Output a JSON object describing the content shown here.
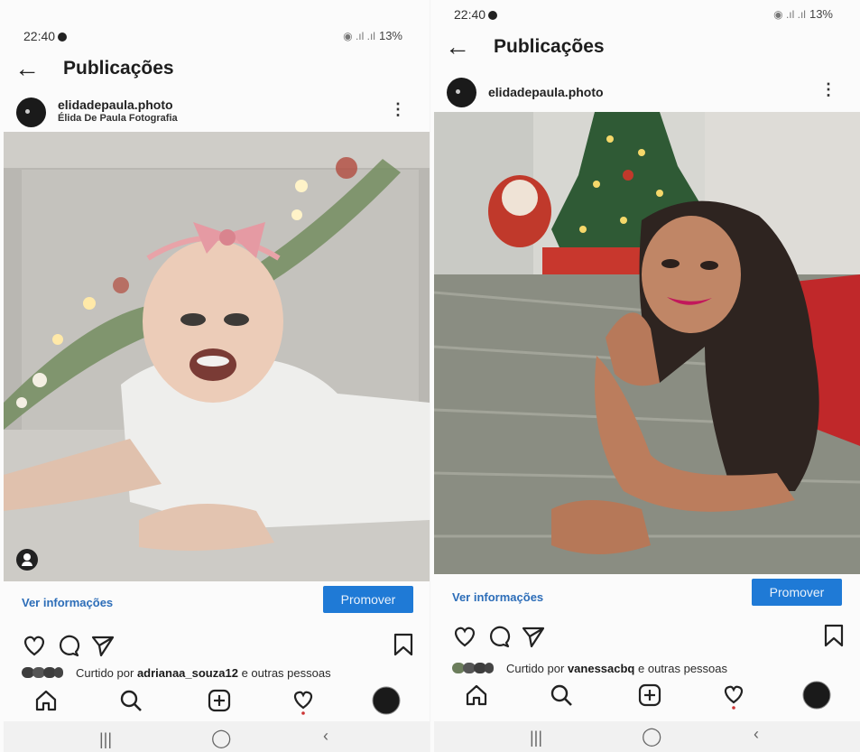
{
  "screens": [
    {
      "status": {
        "time": "22:40",
        "battery": "13%"
      },
      "title": "Publicações",
      "post": {
        "username": "elidadepaula.photo",
        "subtitle": "Élida De Paula Fotografia",
        "info_link": "Ver informações",
        "promote_label": "Promover",
        "liked_prefix": "Curtido por",
        "liked_user": "adrianaa_souza12",
        "liked_suffix": "e outras pessoas"
      }
    },
    {
      "status": {
        "time": "22:40",
        "battery": "13%"
      },
      "title": "Publicações",
      "post": {
        "username": "elidadepaula.photo",
        "subtitle": "",
        "info_link": "Ver informações",
        "promote_label": "Promover",
        "liked_prefix": "Curtido por",
        "liked_user": "vanessacbq",
        "liked_suffix": "e outras pessoas"
      }
    }
  ],
  "icons": {
    "back": "arrow-left-icon",
    "more": "more-vertical-icon",
    "like": "heart-icon",
    "comment": "comment-icon",
    "share": "send-icon",
    "save": "bookmark-icon",
    "nav": [
      "home-icon",
      "search-icon",
      "add-post-icon",
      "activity-heart-icon",
      "profile-avatar-icon"
    ],
    "system": [
      "recent-apps-icon",
      "home-circle-icon",
      "back-chevron-icon"
    ]
  },
  "colors": {
    "accent": "#1f7ad6",
    "link": "#2c6db8"
  }
}
